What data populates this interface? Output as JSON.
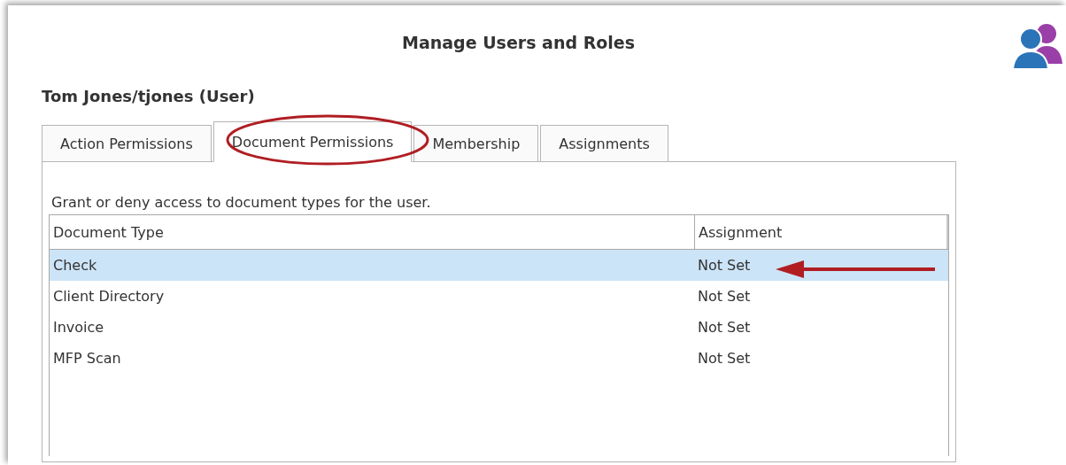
{
  "window": {
    "title": "Manage Users and Roles"
  },
  "user_label": "Tom Jones/tjones (User)",
  "tabs": [
    {
      "label": "Action Permissions",
      "selected": false
    },
    {
      "label": "Document Permissions",
      "selected": true
    },
    {
      "label": "Membership",
      "selected": false
    },
    {
      "label": "Assignments",
      "selected": false
    }
  ],
  "description": "Grant or deny access to document types for the user.",
  "table": {
    "columns": [
      "Document Type",
      "Assignment"
    ],
    "rows": [
      {
        "cells": [
          "Check",
          "Not Set"
        ],
        "selected": true
      },
      {
        "cells": [
          "Client Directory",
          "Not Set"
        ],
        "selected": false
      },
      {
        "cells": [
          "Invoice",
          "Not Set"
        ],
        "selected": false
      },
      {
        "cells": [
          "MFP Scan",
          "Not Set"
        ],
        "selected": false
      }
    ]
  }
}
